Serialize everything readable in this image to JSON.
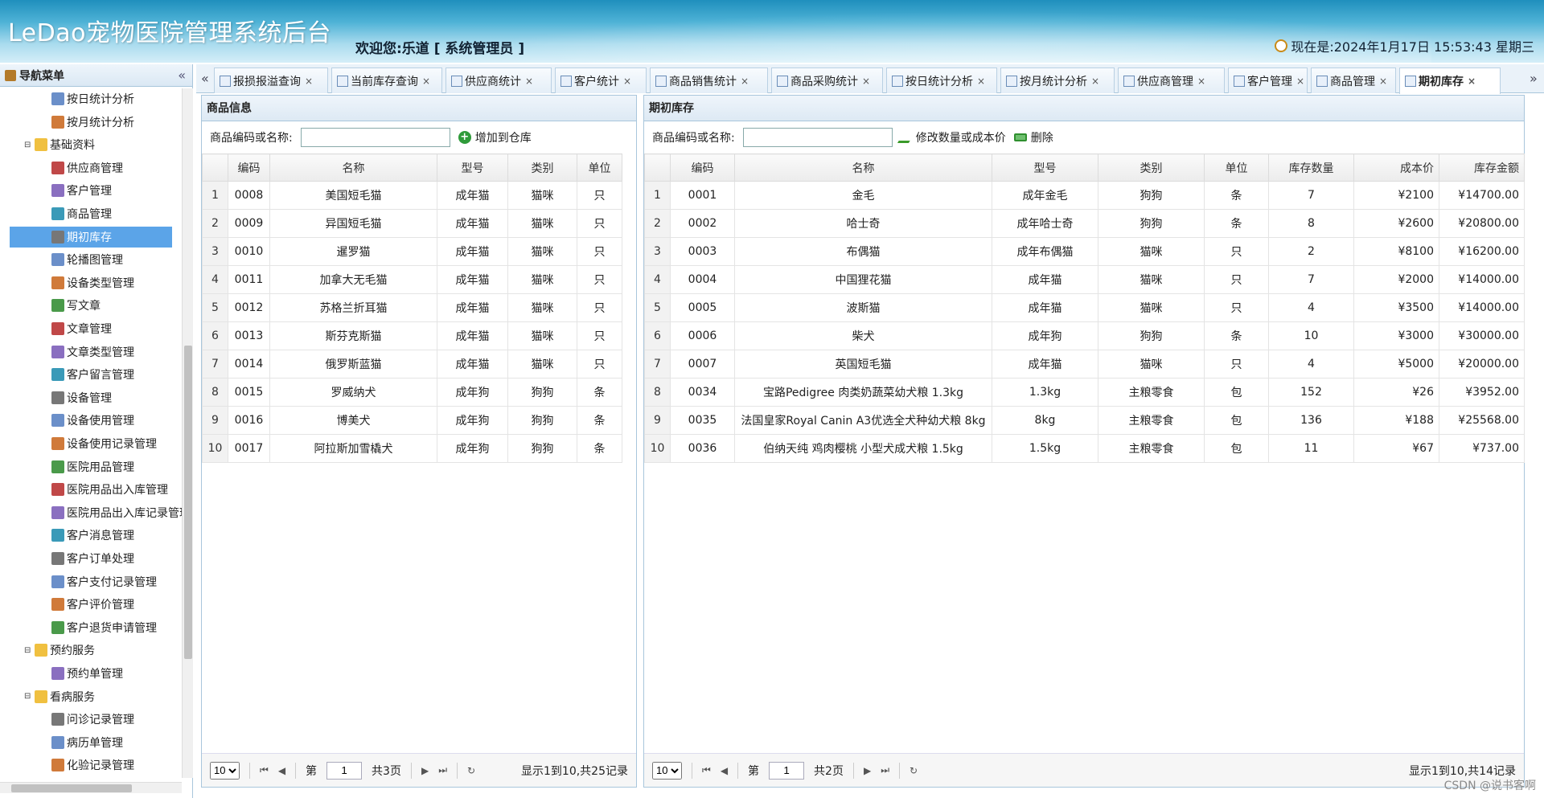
{
  "header": {
    "app_title": "LeDao宠物医院管理系统后台",
    "welcome": "欢迎您:乐道 [ 系统管理员 ]",
    "datetime": "现在是:2024年1月17日 15:53:43 星期三"
  },
  "sidebar": {
    "title": "导航菜单",
    "collapse_icon": "«",
    "items": [
      {
        "label": "按日统计分析",
        "level": 2,
        "icon": "report-icon"
      },
      {
        "label": "按月统计分析",
        "level": 2,
        "icon": "report-icon"
      },
      {
        "label": "基础资料",
        "level": 1,
        "icon": "folder-icon",
        "toggle": "⊟"
      },
      {
        "label": "供应商管理",
        "level": 2,
        "icon": "user-icon"
      },
      {
        "label": "客户管理",
        "level": 2,
        "icon": "user-icon"
      },
      {
        "label": "商品管理",
        "level": 2,
        "icon": "tree-icon"
      },
      {
        "label": "期初库存",
        "level": 2,
        "icon": "stock-icon",
        "selected": true
      },
      {
        "label": "轮播图管理",
        "level": 2,
        "icon": "carousel-icon"
      },
      {
        "label": "设备类型管理",
        "level": 2,
        "icon": "chip-icon"
      },
      {
        "label": "写文章",
        "level": 2,
        "icon": "write-icon"
      },
      {
        "label": "文章管理",
        "level": 2,
        "icon": "doc-icon"
      },
      {
        "label": "文章类型管理",
        "level": 2,
        "icon": "frame-icon"
      },
      {
        "label": "客户留言管理",
        "level": 2,
        "icon": "chat-icon"
      },
      {
        "label": "设备管理",
        "level": 2,
        "icon": "tools-icon"
      },
      {
        "label": "设备使用管理",
        "level": 2,
        "icon": "device-icon"
      },
      {
        "label": "设备使用记录管理",
        "level": 2,
        "icon": "monitor-icon"
      },
      {
        "label": "医院用品管理",
        "level": 2,
        "icon": "bottle-icon"
      },
      {
        "label": "医院用品出入库管理",
        "level": 2,
        "icon": "box-icon"
      },
      {
        "label": "医院用品出入库记录管理",
        "level": 2,
        "icon": "warehouse-icon"
      },
      {
        "label": "客户消息管理",
        "level": 2,
        "icon": "message-icon"
      },
      {
        "label": "客户订单处理",
        "level": 2,
        "icon": "order-icon"
      },
      {
        "label": "客户支付记录管理",
        "level": 2,
        "icon": "pay-icon"
      },
      {
        "label": "客户评价管理",
        "level": 2,
        "icon": "thumb-icon"
      },
      {
        "label": "客户退货申请管理",
        "level": 2,
        "icon": "grid-icon"
      },
      {
        "label": "预约服务",
        "level": 1,
        "icon": "folder-icon",
        "toggle": "⊟"
      },
      {
        "label": "预约单管理",
        "level": 2,
        "icon": "calendar-icon"
      },
      {
        "label": "看病服务",
        "level": 1,
        "icon": "medical-icon",
        "toggle": "⊟"
      },
      {
        "label": "问诊记录管理",
        "level": 2,
        "icon": "record-icon"
      },
      {
        "label": "病历单管理",
        "level": 2,
        "icon": "order-icon"
      },
      {
        "label": "化验记录管理",
        "level": 2,
        "icon": "lab-icon"
      }
    ]
  },
  "tabs": [
    {
      "label": "报损报溢查询"
    },
    {
      "label": "当前库存查询"
    },
    {
      "label": "供应商统计"
    },
    {
      "label": "客户统计"
    },
    {
      "label": "商品销售统计"
    },
    {
      "label": "商品采购统计"
    },
    {
      "label": "按日统计分析"
    },
    {
      "label": "按月统计分析"
    },
    {
      "label": "供应商管理"
    },
    {
      "label": "客户管理"
    },
    {
      "label": "商品管理"
    },
    {
      "label": "期初库存",
      "active": true
    }
  ],
  "tab_nav": {
    "prev": "«",
    "next": "»",
    "close": "×"
  },
  "left_panel": {
    "title": "商品信息",
    "search_label": "商品编码或名称:",
    "search_value": "",
    "add_label": "增加到仓库",
    "columns": [
      "编码",
      "名称",
      "型号",
      "类别",
      "单位"
    ],
    "rows": [
      [
        "0008",
        "美国短毛猫",
        "成年猫",
        "猫咪",
        "只"
      ],
      [
        "0009",
        "异国短毛猫",
        "成年猫",
        "猫咪",
        "只"
      ],
      [
        "0010",
        "暹罗猫",
        "成年猫",
        "猫咪",
        "只"
      ],
      [
        "0011",
        "加拿大无毛猫",
        "成年猫",
        "猫咪",
        "只"
      ],
      [
        "0012",
        "苏格兰折耳猫",
        "成年猫",
        "猫咪",
        "只"
      ],
      [
        "0013",
        "斯芬克斯猫",
        "成年猫",
        "猫咪",
        "只"
      ],
      [
        "0014",
        "俄罗斯蓝猫",
        "成年猫",
        "猫咪",
        "只"
      ],
      [
        "0015",
        "罗威纳犬",
        "成年狗",
        "狗狗",
        "条"
      ],
      [
        "0016",
        "博美犬",
        "成年狗",
        "狗狗",
        "条"
      ],
      [
        "0017",
        "阿拉斯加雪橇犬",
        "成年狗",
        "狗狗",
        "条"
      ]
    ],
    "pager": {
      "page_size": "10",
      "page_prefix": "第",
      "page": "1",
      "page_suffix": "共3页",
      "info": "显示1到10,共25记录"
    }
  },
  "right_panel": {
    "title": "期初库存",
    "search_label": "商品编码或名称:",
    "search_value": "",
    "edit_label": "修改数量或成本价",
    "delete_label": "删除",
    "columns": [
      "编码",
      "名称",
      "型号",
      "类别",
      "单位",
      "库存数量",
      "成本价",
      "库存金额"
    ],
    "rows": [
      [
        "0001",
        "金毛",
        "成年金毛",
        "狗狗",
        "条",
        "7",
        "¥2100",
        "¥14700.00"
      ],
      [
        "0002",
        "哈士奇",
        "成年哈士奇",
        "狗狗",
        "条",
        "8",
        "¥2600",
        "¥20800.00"
      ],
      [
        "0003",
        "布偶猫",
        "成年布偶猫",
        "猫咪",
        "只",
        "2",
        "¥8100",
        "¥16200.00"
      ],
      [
        "0004",
        "中国狸花猫",
        "成年猫",
        "猫咪",
        "只",
        "7",
        "¥2000",
        "¥14000.00"
      ],
      [
        "0005",
        "波斯猫",
        "成年猫",
        "猫咪",
        "只",
        "4",
        "¥3500",
        "¥14000.00"
      ],
      [
        "0006",
        "柴犬",
        "成年狗",
        "狗狗",
        "条",
        "10",
        "¥3000",
        "¥30000.00"
      ],
      [
        "0007",
        "英国短毛猫",
        "成年猫",
        "猫咪",
        "只",
        "4",
        "¥5000",
        "¥20000.00"
      ],
      [
        "0034",
        "宝路Pedigree 肉类奶蔬菜幼犬粮 1.3kg",
        "1.3kg",
        "主粮零食",
        "包",
        "152",
        "¥26",
        "¥3952.00"
      ],
      [
        "0035",
        "法国皇家Royal Canin A3优选全犬种幼犬粮 8kg",
        "8kg",
        "主粮零食",
        "包",
        "136",
        "¥188",
        "¥25568.00"
      ],
      [
        "0036",
        "伯纳天纯 鸡肉樱桃 小型犬成犬粮 1.5kg",
        "1.5kg",
        "主粮零食",
        "包",
        "11",
        "¥67",
        "¥737.00"
      ]
    ],
    "pager": {
      "page_size": "10",
      "page_prefix": "第",
      "page": "1",
      "page_suffix": "共2页",
      "info": "显示1到10,共14记录"
    }
  },
  "watermark": "CSDN @说书客啊"
}
